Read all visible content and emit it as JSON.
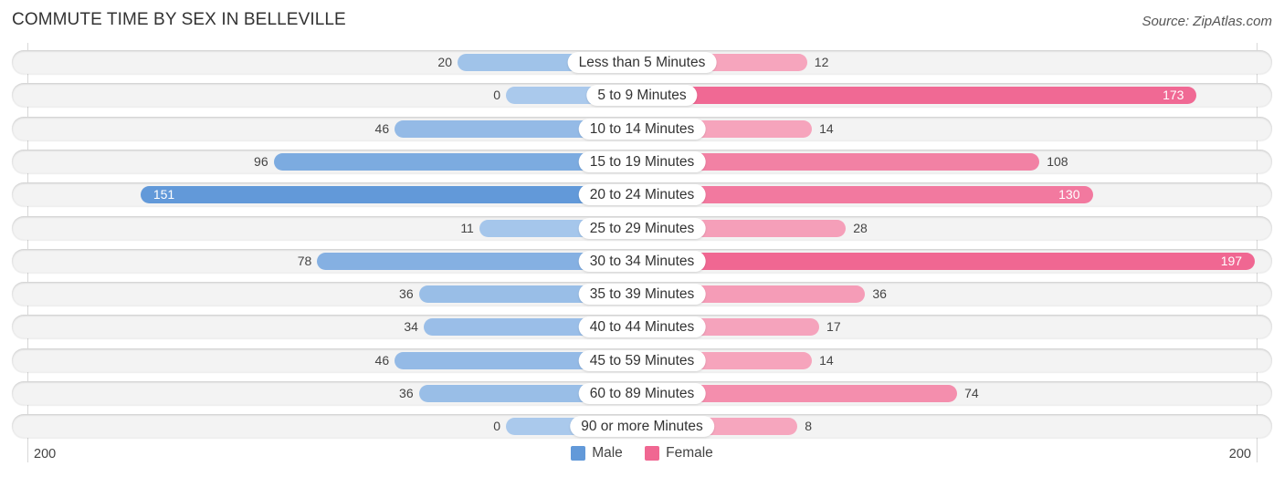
{
  "header": {
    "title": "COMMUTE TIME BY SEX IN BELLEVILLE",
    "source": "Source: ZipAtlas.com"
  },
  "colors": {
    "male_light": "#aac9ec",
    "male_dark": "#6299d9",
    "female_light": "#f6a9c0",
    "female_dark": "#f06792"
  },
  "chart_data": {
    "type": "bar",
    "orientation": "horizontal-diverging",
    "title": "COMMUTE TIME BY SEX IN BELLEVILLE",
    "categories": [
      "Less than 5 Minutes",
      "5 to 9 Minutes",
      "10 to 14 Minutes",
      "15 to 19 Minutes",
      "20 to 24 Minutes",
      "25 to 29 Minutes",
      "30 to 34 Minutes",
      "35 to 39 Minutes",
      "40 to 44 Minutes",
      "45 to 59 Minutes",
      "60 to 89 Minutes",
      "90 or more Minutes"
    ],
    "series": [
      {
        "name": "Male",
        "side": "left",
        "values": [
          20,
          0,
          46,
          96,
          151,
          11,
          78,
          36,
          34,
          46,
          36,
          0
        ]
      },
      {
        "name": "Female",
        "side": "right",
        "values": [
          12,
          173,
          14,
          108,
          130,
          28,
          197,
          36,
          17,
          14,
          74,
          8
        ]
      }
    ],
    "axis": {
      "left_label": "200",
      "right_label": "200",
      "max": 200
    },
    "legend": {
      "position": "bottom-center",
      "items": [
        "Male",
        "Female"
      ]
    },
    "grid": true
  }
}
